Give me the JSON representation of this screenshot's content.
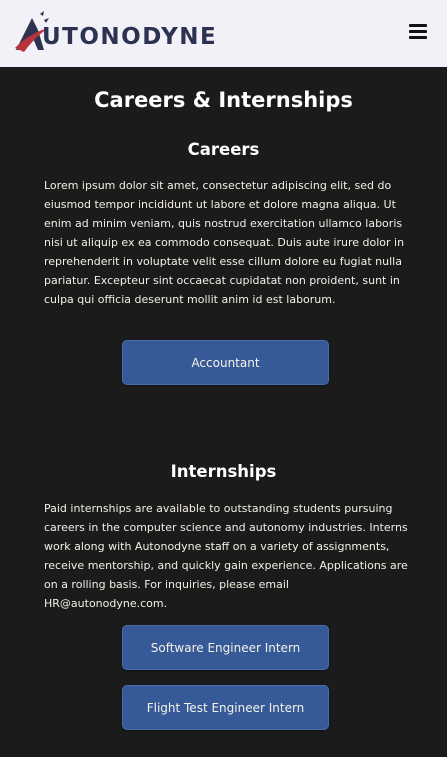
{
  "header": {
    "logo_text": "UTONODYNE",
    "logo_alt": "Autonodyne logo",
    "menu_icon": "hamburger-menu-icon"
  },
  "page": {
    "title": "Careers & Internships"
  },
  "careers": {
    "title": "Careers",
    "description": "Lorem ipsum dolor sit amet, consectetur adipiscing elit, sed do eiusmod tempor incididunt ut labore et dolore magna aliqua. Ut enim ad minim veniam, quis nostrud exercitation ullamco laboris nisi ut aliquip ex ea commodo consequat. Duis aute irure dolor in reprehenderit in voluptate velit esse cillum dolore eu fugiat nulla pariatur. Excepteur sint occaecat cupidatat non proident, sunt in culpa qui officia deserunt mollit anim id est laborum.",
    "buttons": [
      "Accountant"
    ]
  },
  "internships": {
    "title": "Internships",
    "description": "Paid internships are available to outstanding students pursuing careers in the computer science and autonomy industries. Interns work along with Autonodyne staff on a variety of assignments, receive mentorship, and quickly gain experience. Applications are on a rolling basis. For inquiries, please email HR@autonodyne.com.",
    "buttons": [
      "Software Engineer Intern",
      "Flight Test Engineer Intern"
    ]
  },
  "colors": {
    "header_bg": "#f2f1f8",
    "page_bg": "#1b1b1b",
    "button_bg": "#365a97",
    "logo_navy": "#2d3252",
    "logo_red": "#b7323b"
  }
}
